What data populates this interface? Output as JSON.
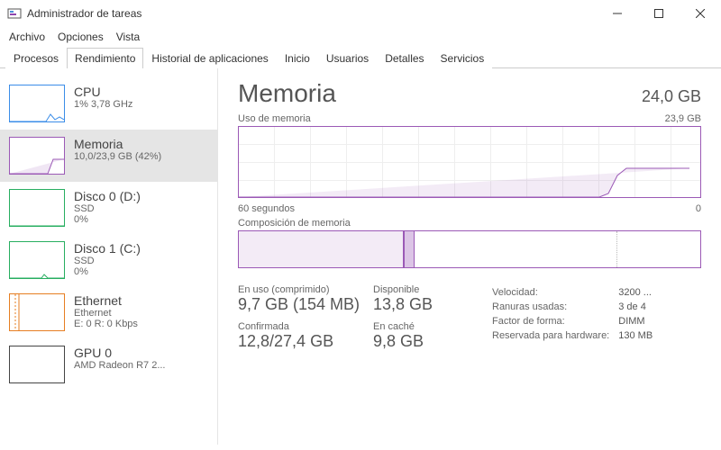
{
  "window": {
    "title": "Administrador de tareas"
  },
  "menu": {
    "file": "Archivo",
    "options": "Opciones",
    "view": "Vista"
  },
  "tabs": {
    "processes": "Procesos",
    "performance": "Rendimiento",
    "app_history": "Historial de aplicaciones",
    "startup": "Inicio",
    "users": "Usuarios",
    "details": "Detalles",
    "services": "Servicios"
  },
  "sidebar": {
    "cpu": {
      "name": "CPU",
      "sub": "1% 3,78 GHz"
    },
    "memory": {
      "name": "Memoria",
      "sub": "10,0/23,9 GB (42%)"
    },
    "disk0": {
      "name": "Disco 0 (D:)",
      "sub1": "SSD",
      "sub2": "0%"
    },
    "disk1": {
      "name": "Disco 1 (C:)",
      "sub1": "SSD",
      "sub2": "0%"
    },
    "ethernet": {
      "name": "Ethernet",
      "sub1": "Ethernet",
      "sub2": "E: 0 R: 0 Kbps"
    },
    "gpu0": {
      "name": "GPU 0",
      "sub1": "AMD Radeon R7 2...",
      "sub2": ""
    }
  },
  "main": {
    "title": "Memoria",
    "total": "24,0 GB",
    "usage_label": "Uso de memoria",
    "usage_max": "23,9 GB",
    "time_left": "60 segundos",
    "time_right": "0",
    "composition_label": "Composición de memoria",
    "in_use_label": "En uso (comprimido)",
    "in_use_value": "9,7 GB (154 MB)",
    "available_label": "Disponible",
    "available_value": "13,8 GB",
    "committed_label": "Confirmada",
    "committed_value": "12,8/27,4 GB",
    "cached_label": "En caché",
    "cached_value": "9,8 GB",
    "speed_label": "Velocidad:",
    "speed_value": "3200 ...",
    "slots_label": "Ranuras usadas:",
    "slots_value": "3 de 4",
    "form_label": "Factor de forma:",
    "form_value": "DIMM",
    "reserved_label": "Reservada para hardware:",
    "reserved_value": "130 MB"
  },
  "chart_data": {
    "type": "line",
    "title": "Uso de memoria",
    "xlabel": "segundos",
    "ylabel": "GB",
    "xlim": [
      60,
      0
    ],
    "ylim": [
      0,
      23.9
    ],
    "x": [
      60,
      12,
      10,
      8,
      6,
      4,
      2,
      0
    ],
    "values": [
      0,
      0,
      3,
      9.5,
      10.0,
      10.0,
      10.0,
      10.0
    ],
    "composition": {
      "in_use_gb": 9.7,
      "compressed_mb": 154,
      "available_gb": 13.8,
      "cached_gb": 9.8,
      "total_gb": 23.9
    }
  }
}
